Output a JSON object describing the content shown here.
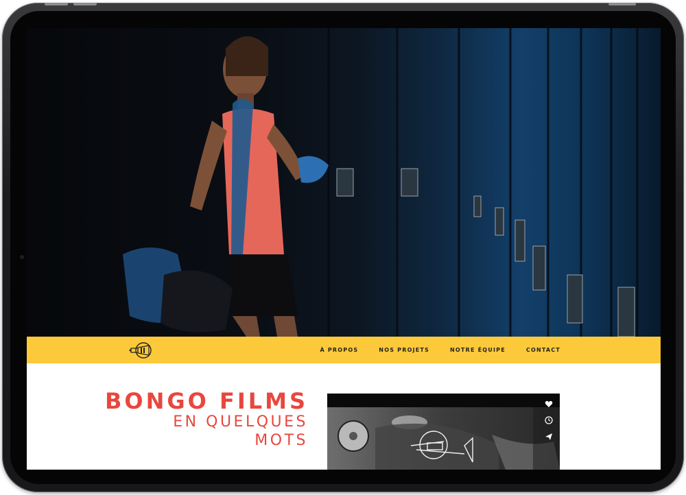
{
  "nav": {
    "items": [
      {
        "label": "À PROPOS"
      },
      {
        "label": "NOS PROJETS"
      },
      {
        "label": "NOTRE ÉQUIPE"
      },
      {
        "label": "CONTACT"
      }
    ]
  },
  "intro": {
    "title_line1": "BONGO FILMS",
    "title_line2": "EN QUELQUES",
    "title_line3": "MOTS"
  },
  "media": {
    "icons": [
      "heart-icon",
      "clock-icon",
      "send-icon"
    ]
  },
  "colors": {
    "accent_yellow": "#fcc93a",
    "title_red": "#e8473e",
    "frame": "#1c1c1e"
  }
}
